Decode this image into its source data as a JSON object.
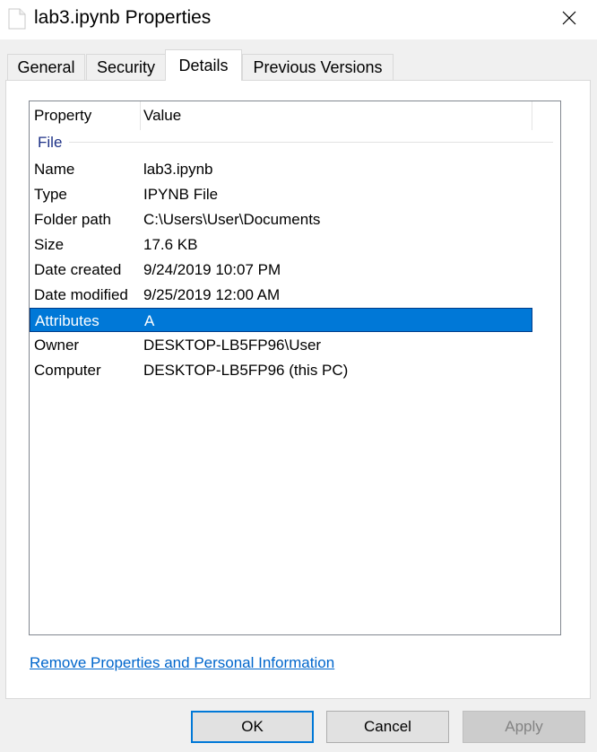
{
  "window": {
    "title": "lab3.ipynb Properties"
  },
  "tabs": [
    {
      "label": "General",
      "selected": false
    },
    {
      "label": "Security",
      "selected": false
    },
    {
      "label": "Details",
      "selected": true
    },
    {
      "label": "Previous Versions",
      "selected": false
    }
  ],
  "details": {
    "columns": {
      "property": "Property",
      "value": "Value"
    },
    "group": "File",
    "rows": [
      {
        "property": "Name",
        "value": "lab3.ipynb",
        "selected": false
      },
      {
        "property": "Type",
        "value": "IPYNB File",
        "selected": false
      },
      {
        "property": "Folder path",
        "value": "C:\\Users\\User\\Documents",
        "selected": false
      },
      {
        "property": "Size",
        "value": "17.6 KB",
        "selected": false
      },
      {
        "property": "Date created",
        "value": "9/24/2019 10:07 PM",
        "selected": false
      },
      {
        "property": "Date modified",
        "value": "9/25/2019 12:00 AM",
        "selected": false
      },
      {
        "property": "Attributes",
        "value": "A",
        "selected": true
      },
      {
        "property": "Owner",
        "value": "DESKTOP-LB5FP96\\User",
        "selected": false
      },
      {
        "property": "Computer",
        "value": "DESKTOP-LB5FP96 (this PC)",
        "selected": false
      }
    ]
  },
  "remove_link": "Remove Properties and Personal Information",
  "buttons": {
    "ok": "OK",
    "cancel": "Cancel",
    "apply": "Apply",
    "apply_enabled": false
  },
  "colors": {
    "selection": "#0078d7",
    "link": "#0066cc",
    "group_header": "#1e3287"
  }
}
